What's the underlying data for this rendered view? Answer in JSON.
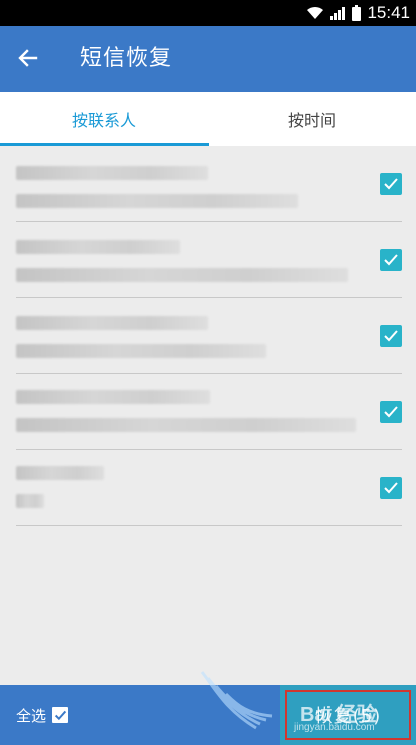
{
  "status_bar": {
    "time": "15:41",
    "icons": [
      "wifi-icon",
      "signal-icon",
      "battery-icon"
    ]
  },
  "app_bar": {
    "title": "短信恢复",
    "back_icon": "arrow-left-icon"
  },
  "tabs": [
    {
      "label": "按联系人",
      "active": true
    },
    {
      "label": "按时间",
      "active": false
    }
  ],
  "messages": [
    {
      "checked": true,
      "blurred": true
    },
    {
      "checked": true,
      "blurred": true
    },
    {
      "checked": true,
      "blurred": true
    },
    {
      "checked": true,
      "blurred": true
    },
    {
      "checked": true,
      "blurred": true
    }
  ],
  "bottom_bar": {
    "select_all_label": "全选",
    "select_all_checked": true,
    "recover_label": "恢复(5)"
  },
  "watermark": {
    "brand": "Bai 经验",
    "url": "jingyan.baidu.com"
  },
  "colors": {
    "primary": "#3b79c7",
    "tab_active": "#1a9ad6",
    "checkbox": "#29b3c9",
    "background": "#ececec",
    "highlight_border": "#d0362f"
  }
}
